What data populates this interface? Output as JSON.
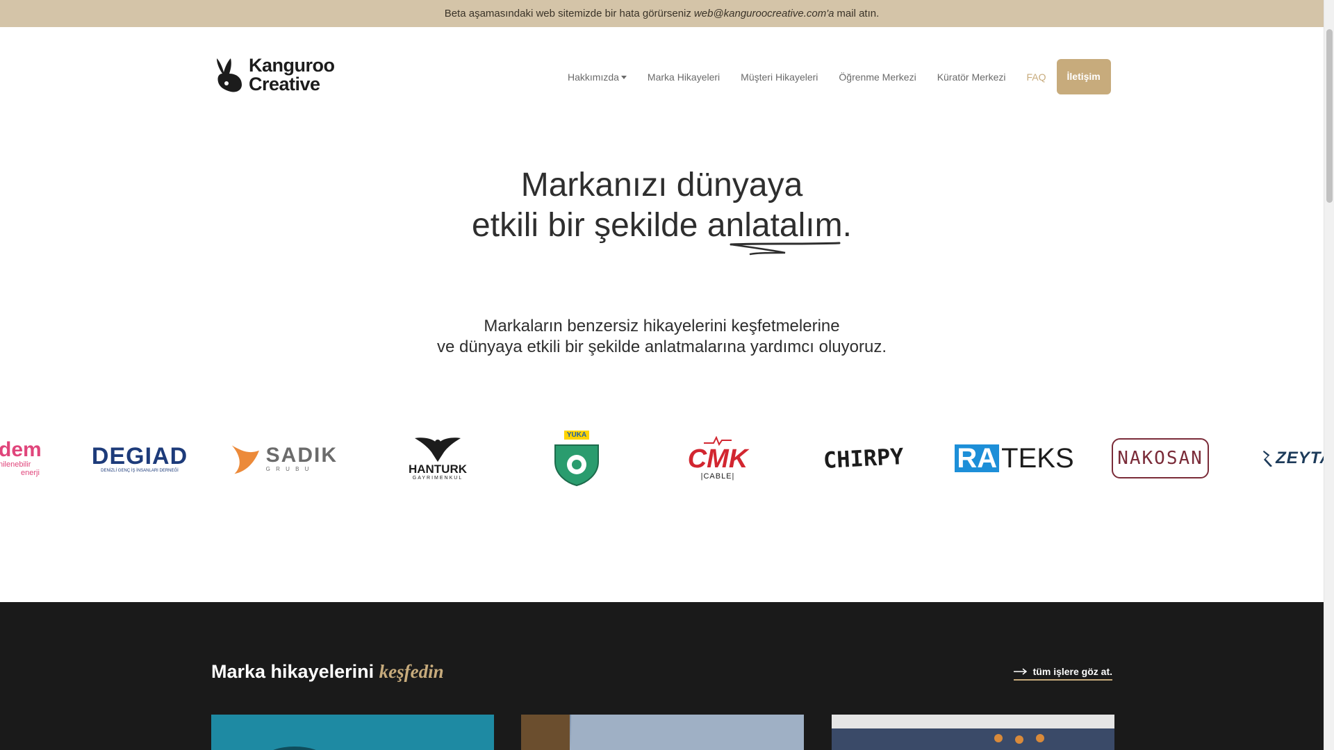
{
  "beta_bar": {
    "text_before": "Beta aşamasındaki web sitemizde bir hata görürseniz",
    "email": "web@kanguroocreative.com'a",
    "text_after": "mail atın."
  },
  "logo": {
    "line1": "Kanguroo",
    "line2": "Creative"
  },
  "nav": {
    "items": [
      {
        "label": "Hakkımızda",
        "dropdown": true
      },
      {
        "label": "Marka Hikayeleri"
      },
      {
        "label": "Müşteri Hikayeleri"
      },
      {
        "label": "Öğrenme Merkezi"
      },
      {
        "label": "Küratör Merkezi"
      },
      {
        "label": "FAQ"
      }
    ],
    "contact_label": "İletişim"
  },
  "hero": {
    "title_line1": "Markanızı dünyaya",
    "title_line2": "etkili bir şekilde anlatalım."
  },
  "subtitle": {
    "line1": "Markaların benzersiz hikayelerini keşfetmelerine",
    "line2": "ve dünyaya etkili bir şekilde anlatmalarına yardımcı oluyoruz."
  },
  "brands": {
    "adem": {
      "name": "dem",
      "tag": "nilenebilir",
      "tag2": "enerji"
    },
    "degiad": {
      "name": "DEGIAD",
      "tag": "DENİZLİ GENÇ İŞ İNSANLARI DERNEĞİ"
    },
    "sadik": {
      "name": "SADIK",
      "tag": "G R U B U"
    },
    "hanturk": {
      "name": "HANTURK",
      "tag": "GAYRIMENKUL"
    },
    "yuka": {
      "name": "YUKA"
    },
    "cmk": {
      "name": "CMK",
      "tag": "|CABLE|"
    },
    "chirpy": {
      "name": "CHIRPY"
    },
    "rateks": {
      "name_a": "RA",
      "name_b": "TEKS"
    },
    "nakosan": {
      "name": "NAKOSAN"
    },
    "zeyta": {
      "name": "ZEYTA"
    }
  },
  "stories": {
    "title": "Marka hikayelerini",
    "title_accent": "keşfedin",
    "all_link": "tüm işlere göz at."
  },
  "colors": {
    "accent": "#c7ab7c",
    "beta_bg": "#d4c4a8",
    "dark_bg": "#1a1a1a"
  }
}
